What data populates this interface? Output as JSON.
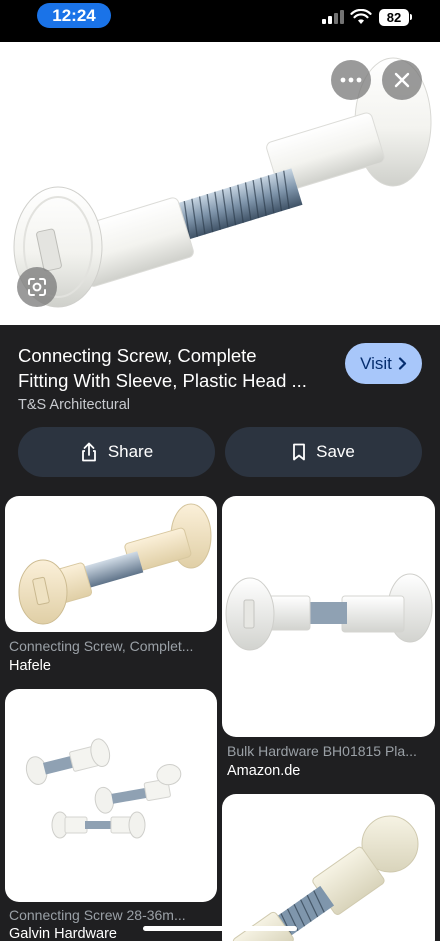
{
  "status_bar": {
    "time": "12:24",
    "battery": "82"
  },
  "hero": {
    "image_alt": "Connecting screw with sleeve, white plastic heads"
  },
  "result": {
    "title_line1": "Connecting Screw, Complete",
    "title_line2": "Fitting With Sleeve, Plastic Head ...",
    "source": "T&S Architectural",
    "visit_label": "Visit",
    "share_label": "Share",
    "save_label": "Save"
  },
  "related": [
    {
      "title": "Connecting Screw, Complet...",
      "source": "Hafele"
    },
    {
      "title": "Bulk Hardware BH01815 Pla...",
      "source": "Amazon.de"
    },
    {
      "title": "Connecting Screw 28-36m...",
      "source": "Galvin Hardware"
    }
  ],
  "icons": [
    "more-horizontal-icon",
    "close-icon",
    "lens-icon",
    "chevron-right-icon",
    "share-icon",
    "bookmark-icon",
    "signal-icon",
    "wifi-icon",
    "battery-icon"
  ]
}
